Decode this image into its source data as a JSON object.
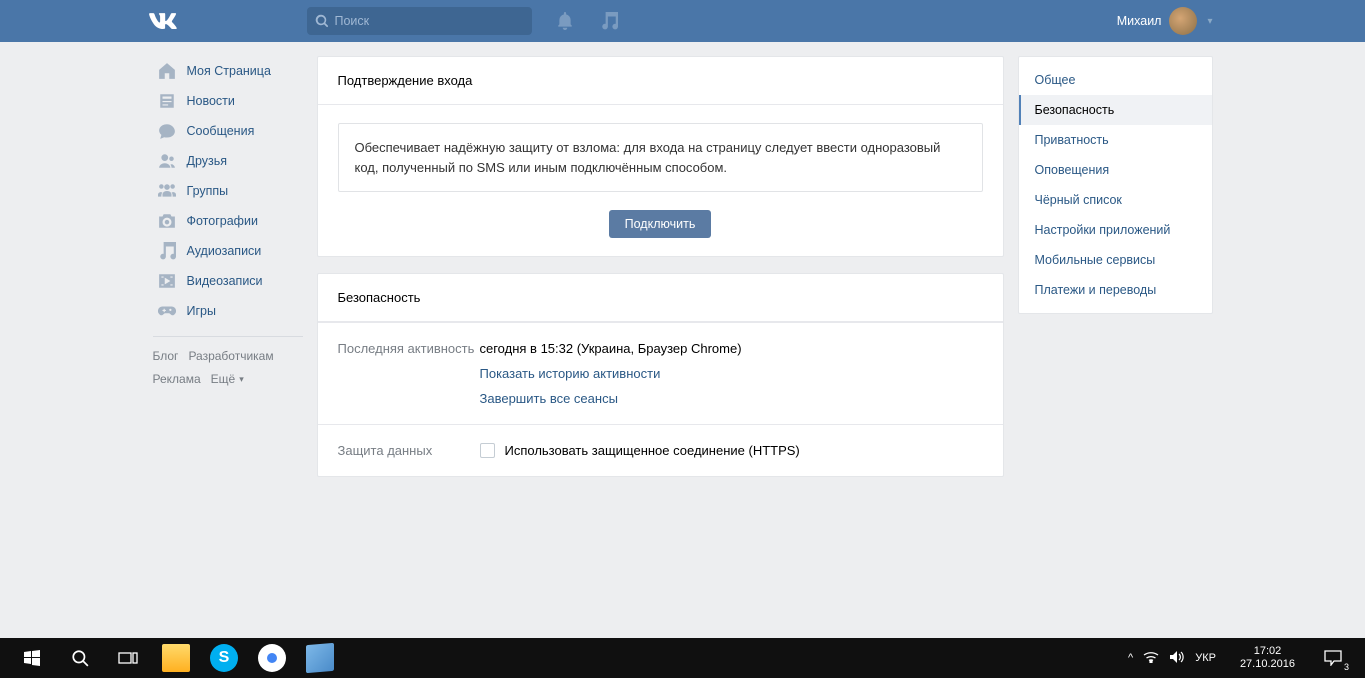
{
  "header": {
    "search_placeholder": "Поиск",
    "username": "Михаил"
  },
  "nav": {
    "items": [
      {
        "label": "Моя Страница"
      },
      {
        "label": "Новости"
      },
      {
        "label": "Сообщения"
      },
      {
        "label": "Друзья"
      },
      {
        "label": "Группы"
      },
      {
        "label": "Фотографии"
      },
      {
        "label": "Аудиозаписи"
      },
      {
        "label": "Видеозаписи"
      },
      {
        "label": "Игры"
      }
    ],
    "links": {
      "blog": "Блог",
      "developers": "Разработчикам",
      "ads": "Реклама",
      "more": "Ещё"
    }
  },
  "confirm_panel": {
    "title": "Подтверждение входа",
    "info": "Обеспечивает надёжную защиту от взлома: для входа на страницу следует ввести одноразовый код, полученный по SMS или иным подключённым способом.",
    "button": "Подключить"
  },
  "security_panel": {
    "title": "Безопасность",
    "last_activity_label": "Последняя активность",
    "last_activity_value": "сегодня в 15:32 (Украина, Браузер Chrome)",
    "show_history": "Показать историю активности",
    "end_sessions": "Завершить все сеансы",
    "data_protection_label": "Защита данных",
    "https_label": "Использовать защищенное соединение (HTTPS)"
  },
  "tabs": {
    "items": [
      {
        "label": "Общее"
      },
      {
        "label": "Безопасность"
      },
      {
        "label": "Приватность"
      },
      {
        "label": "Оповещения"
      },
      {
        "label": "Чёрный список"
      },
      {
        "label": "Настройки приложений"
      },
      {
        "label": "Мобильные сервисы"
      },
      {
        "label": "Платежи и переводы"
      }
    ]
  },
  "taskbar": {
    "lang": "УКР",
    "time": "17:02",
    "date": "27.10.2016",
    "badge": "3"
  }
}
